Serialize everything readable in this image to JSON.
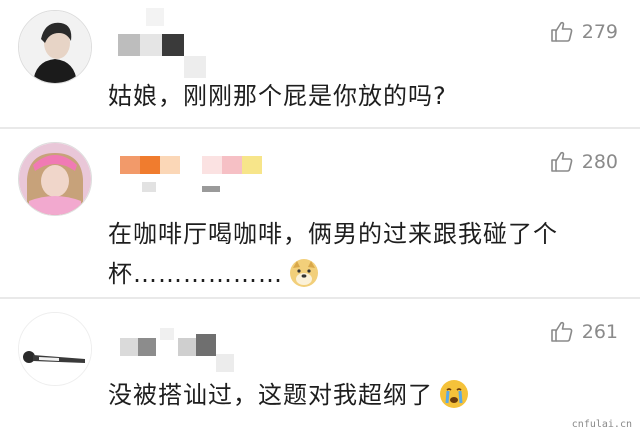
{
  "comments": [
    {
      "likes": "279",
      "text": "姑娘，刚刚那个屁是你放的吗?"
    },
    {
      "likes": "280",
      "text_line1": "在咖啡厅喝咖啡，俩男的过来跟我碰了个",
      "text_line2": "杯………………"
    },
    {
      "likes": "261",
      "text": "没被搭讪过，这题对我超纲了"
    }
  ],
  "watermark": "cnfulai.cn",
  "icons": {
    "like": "thumbs-up-icon",
    "doge": "doge-emoji-icon",
    "crying": "crying-face-emoji-icon"
  },
  "colors": {
    "background": "#ffffff",
    "text": "#1e1e1e",
    "count": "#8a8a8a",
    "divider": "#e9e9e9"
  }
}
